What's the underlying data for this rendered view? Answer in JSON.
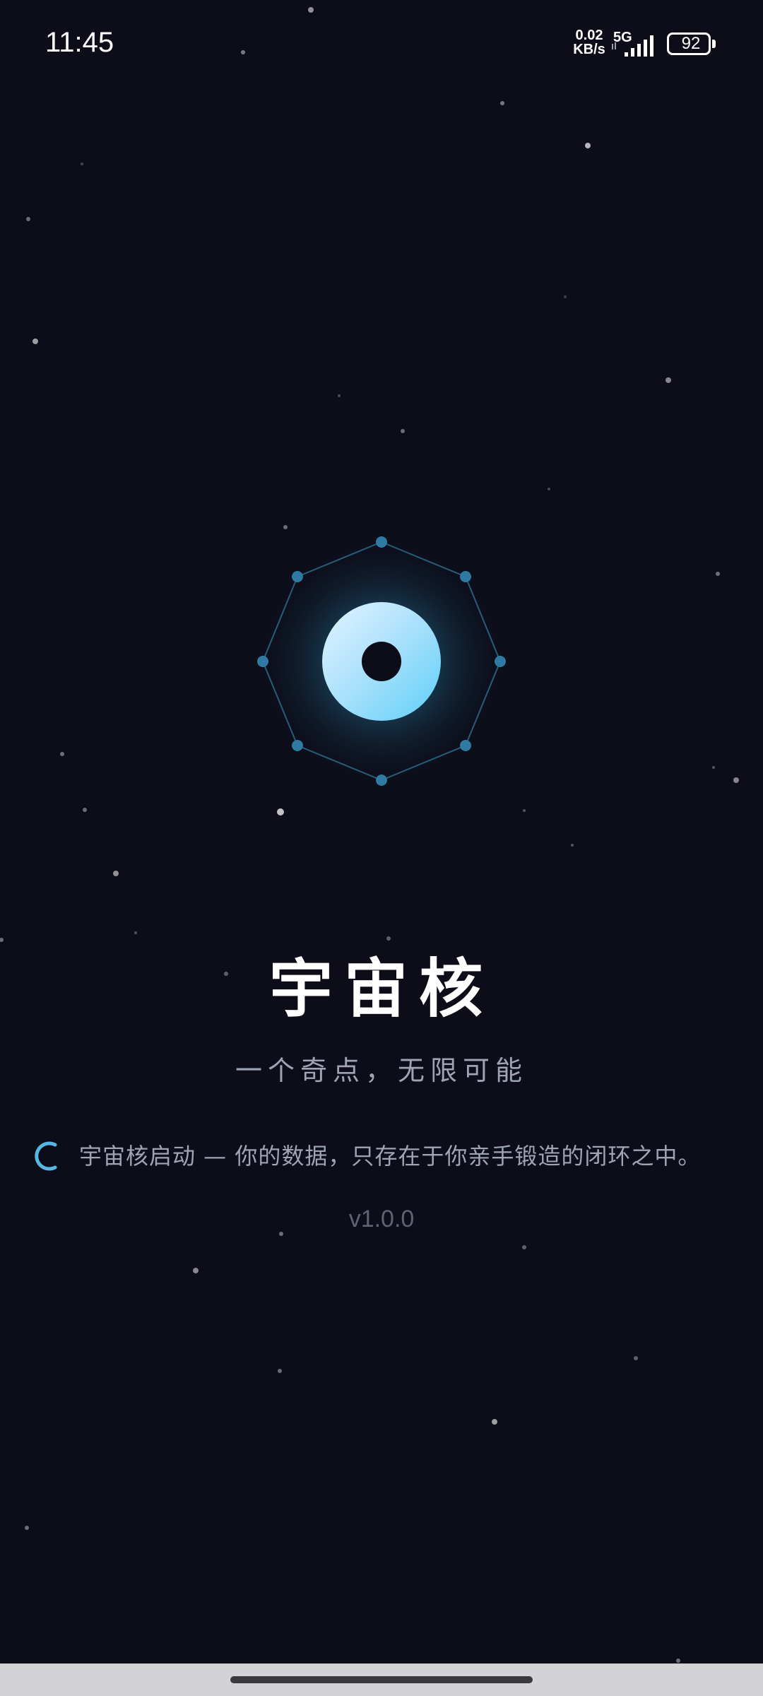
{
  "status_bar": {
    "time": "11:45",
    "net_speed_value": "0.02",
    "net_speed_unit": "KB/s",
    "network_type": "5G",
    "battery_level": "92",
    "icons": [
      "signal-icon",
      "battery-icon"
    ]
  },
  "splash": {
    "title": "宇宙核",
    "tagline": "一个奇点，无限可能",
    "loading_message": "宇宙核启动 — 你的数据，只存在于你亲手锻造的闭环之中。",
    "version": "v1.0.0",
    "icons": [
      "core-logo-icon",
      "loading-spinner-icon"
    ]
  },
  "colors": {
    "background": "#0c0d18",
    "accent": "#6fd4f6",
    "title": "#ffffff",
    "subtitle": "#9ea4b3",
    "version": "#5e6373",
    "nav_bar": "#d3d3d6"
  }
}
